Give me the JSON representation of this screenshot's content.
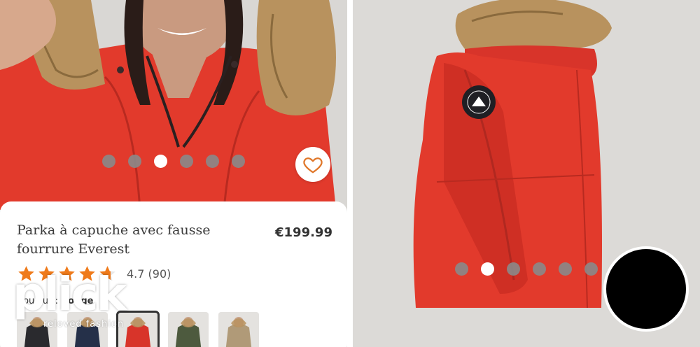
{
  "product": {
    "title_line1": "Parka à capuche avec fausse",
    "title_line2": "fourrure Everest",
    "price": "€199.99"
  },
  "rating": {
    "value": "4.7",
    "count": "(90)",
    "stars": 4.7,
    "star_color": "#ef7a1a"
  },
  "color_selector": {
    "label": "Couleur",
    "separator": " : ",
    "selected": "Rouge"
  },
  "gallery": {
    "left_active_index": 3,
    "left_total": 6,
    "right_active_index": 2,
    "right_total": 6
  },
  "swatches": [
    {
      "name": "black-swatch",
      "color": "#2a2a2e"
    },
    {
      "name": "navy-swatch",
      "color": "#253049"
    },
    {
      "name": "red-swatch",
      "color": "#d8342a"
    },
    {
      "name": "khaki-swatch",
      "color": "#4d5a3e"
    },
    {
      "name": "beige-swatch",
      "color": "#b09a78"
    }
  ],
  "watermark": {
    "logo": "plick",
    "tagline": "reloved fashion"
  },
  "colors": {
    "jacket_red": "#e23a2c",
    "fur": "#b8925e",
    "background": "#dcdad7",
    "heart": "#e0772a"
  }
}
